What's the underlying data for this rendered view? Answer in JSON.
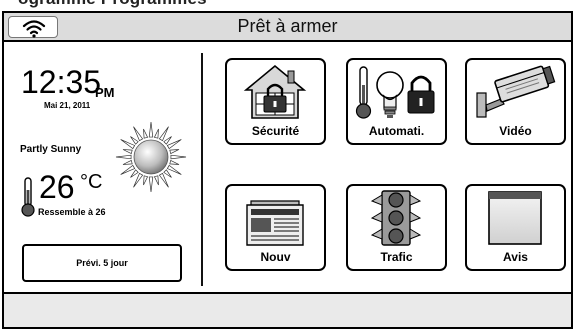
{
  "caption": "ogramme Programmes",
  "status_bar": {
    "title": "Prêt à armer",
    "wifi_icon": "wifi-icon"
  },
  "clock": {
    "time": "12:35",
    "ampm": "PM",
    "date": "Mai 21, 2011"
  },
  "weather": {
    "condition": "Partly Sunny",
    "temperature": "26",
    "unit": "°C",
    "feels_like": "Ressemble à 26",
    "forecast_button": "Prévi. 5 jour",
    "icon": "partly-sunny-icon"
  },
  "tiles": [
    {
      "label": "Sécurité",
      "icon": "security-house-lock-icon"
    },
    {
      "label": "Automati.",
      "icon": "automation-thermometer-bulb-lock-icon"
    },
    {
      "label": "Vidéo",
      "icon": "security-camera-icon"
    },
    {
      "label": "Nouv",
      "icon": "newspaper-icon"
    },
    {
      "label": "Trafic",
      "icon": "traffic-light-icon"
    },
    {
      "label": "Avis",
      "icon": "notice-page-icon"
    }
  ],
  "colors": {
    "topbar": "#dcdcdc",
    "bottombar": "#eaeaea",
    "border": "#000000"
  }
}
